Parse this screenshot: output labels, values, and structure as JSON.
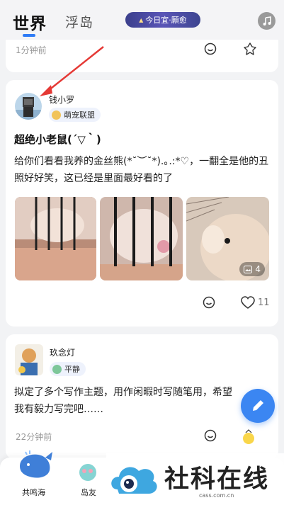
{
  "header": {
    "tab_world": "世界",
    "tab_island": "浮岛",
    "promo_label": "今日宜·願愈",
    "music_icon": "music-note-icon"
  },
  "posts": [
    {
      "time": "1分钟前"
    },
    {
      "username": "钱小罗",
      "badge": "萌宠联盟",
      "title": "超绝小老鼠(´▽｀)",
      "body": "给你们看看我养的金丝熊(*˘︶˘*).｡.:*♡，一翻全是他的丑照好好笑，这已经是里面最好看的了",
      "image_count": "4",
      "likes": "11"
    },
    {
      "username": "玖念灯",
      "badge": "平静",
      "body": "拟定了多个写作主题，用作闲暇时写随笔用，希望我有毅力写完吧……",
      "time": "22分钟前"
    }
  ],
  "bottom_nav": {
    "item1": "共鸣海",
    "item2": "岛友"
  },
  "watermark": {
    "title": "社科在线",
    "url": "cass.com.cn"
  },
  "colors": {
    "accent": "#2f7cf6",
    "fab": "#3b86f2",
    "annotation_arrow": "#e53935"
  }
}
